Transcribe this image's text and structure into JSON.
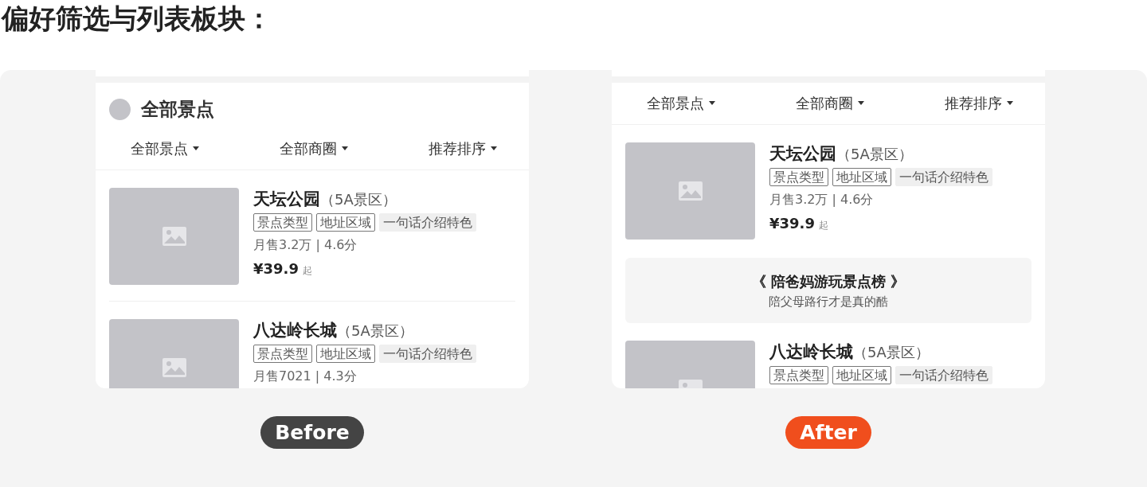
{
  "heading": "偏好筛选与列表板块：",
  "panels": [
    {
      "header": {
        "title": "全部景点"
      },
      "filters": [
        {
          "label": "全部景点"
        },
        {
          "label": "全部商圈"
        },
        {
          "label": "推荐排序"
        }
      ],
      "items": [
        {
          "kind": "spot",
          "name": "天坛公园",
          "level": "（5A景区）",
          "tags": [
            {
              "kind": "outline",
              "text": "景点类型"
            },
            {
              "kind": "outline",
              "text": "地址区域"
            },
            {
              "kind": "filled",
              "text": "一句话介绍特色"
            }
          ],
          "stats": "月售3.2万 | 4.6分",
          "price": "¥39.9",
          "price_suffix": "起"
        },
        {
          "kind": "spot",
          "name": "八达岭长城",
          "level": "（5A景区）",
          "tags": [
            {
              "kind": "outline",
              "text": "景点类型"
            },
            {
              "kind": "outline",
              "text": "地址区域"
            },
            {
              "kind": "filled",
              "text": "一句话介绍特色"
            }
          ],
          "stats": "月售7021 | 4.3分"
        }
      ],
      "badge": {
        "kind": "before",
        "label": "Before"
      }
    },
    {
      "filters": [
        {
          "label": "全部景点"
        },
        {
          "label": "全部商圈"
        },
        {
          "label": "推荐排序"
        }
      ],
      "items": [
        {
          "kind": "spot",
          "name": "天坛公园",
          "level": "（5A景区）",
          "tags": [
            {
              "kind": "outline",
              "text": "景点类型"
            },
            {
              "kind": "outline",
              "text": "地址区域"
            },
            {
              "kind": "filled",
              "text": "一句话介绍特色"
            }
          ],
          "stats": "月售3.2万 | 4.6分",
          "price": "¥39.9",
          "price_suffix": "起"
        },
        {
          "kind": "banner",
          "title": "《 陪爸妈游玩景点榜 》",
          "subtitle": "陪父母路行才是真的酷"
        },
        {
          "kind": "spot",
          "name": "八达岭长城",
          "level": "（5A景区）",
          "tags": [
            {
              "kind": "outline",
              "text": "景点类型"
            },
            {
              "kind": "outline",
              "text": "地址区域"
            },
            {
              "kind": "filled",
              "text": "一句话介绍特色"
            }
          ]
        }
      ],
      "badge": {
        "kind": "after",
        "label": "After"
      }
    }
  ]
}
